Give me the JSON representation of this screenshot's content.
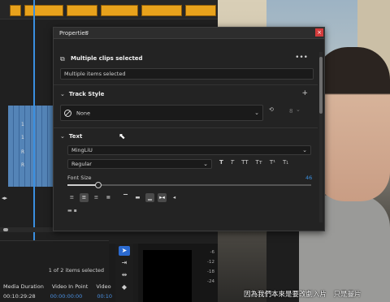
{
  "properties_panel": {
    "title": "Properties",
    "menu_icon": "hamburger-icon",
    "close_icon": "close-icon",
    "selection_label": "Multiple clips selected",
    "name_field_value": "Multiple items selected",
    "track_style": {
      "header": "Track Style",
      "selected": "None",
      "counter": "8"
    },
    "text": {
      "header": "Text",
      "font": "MingLiU",
      "weight": "Regular",
      "type_buttons": [
        "T",
        "T",
        "TT",
        "Tт",
        "T¹",
        "T₁"
      ],
      "font_size_label": "Font Size",
      "font_size_value": "46"
    },
    "accent_color": "#3a8fe0"
  },
  "project_panel": {
    "selected_count": "1 of 2 items selected",
    "columns": [
      "Media Duration",
      "Video In Point",
      "Video"
    ],
    "row": {
      "duration": "00:10:29:28",
      "in_point": "00:00:00:00",
      "video": "00:10"
    }
  },
  "audio_meter": {
    "ticks": [
      "-6",
      "-12",
      "-18",
      "-24"
    ]
  },
  "video": {
    "subtitle": "因為我們本來是要改劇入片　只是曼片"
  },
  "timeline": {
    "track_labels": [
      "1",
      "1",
      "R",
      "R",
      "R",
      "R"
    ]
  }
}
